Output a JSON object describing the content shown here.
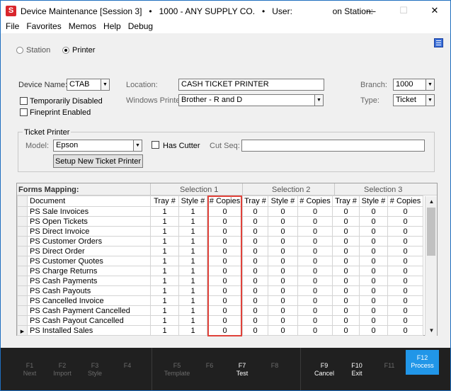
{
  "window": {
    "app_icon": "S",
    "title": "Device Maintenance [Session 3]   •   1000 - ANY SUPPLY CO.   •   User:                 on Station:",
    "min": "—",
    "max": "☐",
    "close": "✕"
  },
  "menu": [
    "File",
    "Favorites",
    "Memos",
    "Help",
    "Debug"
  ],
  "mode": {
    "station_label": "Station",
    "printer_label": "Printer",
    "selected": "Printer"
  },
  "device": {
    "name_label": "Device Name:",
    "name_value": "CTAB",
    "temp_disabled_label": "Temporarily Disabled",
    "fineprint_label": "Fineprint Enabled",
    "location_label": "Location:",
    "location_value": "CASH TICKET PRINTER",
    "windows_printer_label": "Windows Printer:",
    "windows_printer_value": "Brother - R and D",
    "branch_label": "Branch:",
    "branch_value": "1000",
    "type_label": "Type:",
    "type_value": "Ticket"
  },
  "ticket_printer": {
    "group_title": "Ticket Printer",
    "model_label": "Model:",
    "model_value": "Epson",
    "has_cutter_label": "Has Cutter",
    "cut_seq_label": "Cut Seq:",
    "cut_seq_value": "",
    "setup_button": "Setup New Ticket Printer"
  },
  "forms_mapping": {
    "title": "Forms Mapping:",
    "selections": [
      "Selection 1",
      "Selection 2",
      "Selection 3"
    ],
    "columns": [
      "Document",
      "Tray #",
      "Style #",
      "# Copies",
      "Tray #",
      "Style #",
      "# Copies",
      "Tray #",
      "Style #",
      "# Copies"
    ],
    "rows": [
      [
        "PS Sale Invoices",
        "1",
        "1",
        "0",
        "0",
        "0",
        "0",
        "0",
        "0",
        "0"
      ],
      [
        "PS Open Tickets",
        "1",
        "1",
        "0",
        "0",
        "0",
        "0",
        "0",
        "0",
        "0"
      ],
      [
        "PS Direct Invoice",
        "1",
        "1",
        "0",
        "0",
        "0",
        "0",
        "0",
        "0",
        "0"
      ],
      [
        "PS Customer Orders",
        "1",
        "1",
        "0",
        "0",
        "0",
        "0",
        "0",
        "0",
        "0"
      ],
      [
        "PS Direct Order",
        "1",
        "1",
        "0",
        "0",
        "0",
        "0",
        "0",
        "0",
        "0"
      ],
      [
        "PS Customer Quotes",
        "1",
        "1",
        "0",
        "0",
        "0",
        "0",
        "0",
        "0",
        "0"
      ],
      [
        "PS Charge Returns",
        "1",
        "1",
        "0",
        "0",
        "0",
        "0",
        "0",
        "0",
        "0"
      ],
      [
        "PS Cash Payments",
        "1",
        "1",
        "0",
        "0",
        "0",
        "0",
        "0",
        "0",
        "0"
      ],
      [
        "PS Cash Payouts",
        "1",
        "1",
        "0",
        "0",
        "0",
        "0",
        "0",
        "0",
        "0"
      ],
      [
        "PS Cancelled Invoice",
        "1",
        "1",
        "0",
        "0",
        "0",
        "0",
        "0",
        "0",
        "0"
      ],
      [
        "PS Cash Payment Cancelled",
        "1",
        "1",
        "0",
        "0",
        "0",
        "0",
        "0",
        "0",
        "0"
      ],
      [
        "PS Cash Payout Cancelled",
        "1",
        "1",
        "0",
        "0",
        "0",
        "0",
        "0",
        "0",
        "0"
      ],
      [
        "PS Installed Sales",
        "1",
        "1",
        "0",
        "0",
        "0",
        "0",
        "0",
        "0",
        "0"
      ]
    ],
    "current_row_indicator": "▶"
  },
  "fkeys": [
    {
      "key": "F1",
      "label": "Next",
      "enabled": false
    },
    {
      "key": "F2",
      "label": "Import",
      "enabled": false
    },
    {
      "key": "F3",
      "label": "Style",
      "enabled": false
    },
    {
      "key": "F4",
      "label": "",
      "enabled": false
    },
    {
      "key": "F5",
      "label": "Template",
      "enabled": false
    },
    {
      "key": "F6",
      "label": "",
      "enabled": false
    },
    {
      "key": "F7",
      "label": "Test",
      "enabled": true
    },
    {
      "key": "F8",
      "label": "",
      "enabled": false
    },
    {
      "key": "F9",
      "label": "Cancel",
      "enabled": true
    },
    {
      "key": "F10",
      "label": "Exit",
      "enabled": true
    },
    {
      "key": "F11",
      "label": "",
      "enabled": false
    },
    {
      "key": "F12",
      "label": "Process",
      "enabled": true,
      "primary": true
    }
  ],
  "colors": {
    "primary_key": "#2196e8",
    "highlight_box": "#e0423a",
    "footer_bg": "#202020"
  }
}
